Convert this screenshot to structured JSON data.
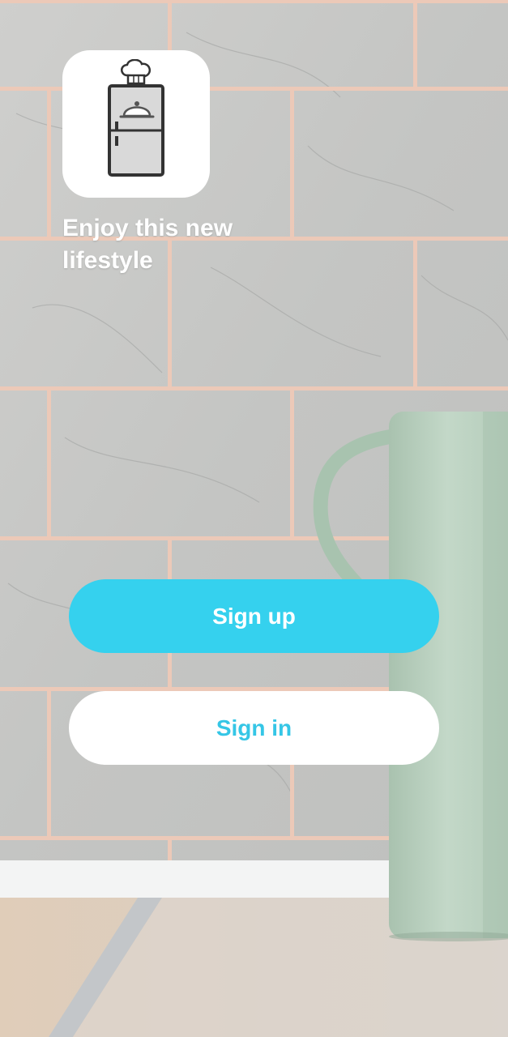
{
  "app": {
    "tagline": "Enjoy this new lifestyle",
    "logo_icon": "fridge-chef-icon"
  },
  "actions": {
    "sign_up_label": "Sign up",
    "sign_in_label": "Sign in"
  },
  "colors": {
    "accent": "#35d1ee",
    "sign_in_text": "#35c6e6",
    "button_light": "#ffffff",
    "wall_tile": "#c9c9c7",
    "grout": "#ecc9b8",
    "mug": "#b9d0bf",
    "counter": "#d9c7b4"
  }
}
